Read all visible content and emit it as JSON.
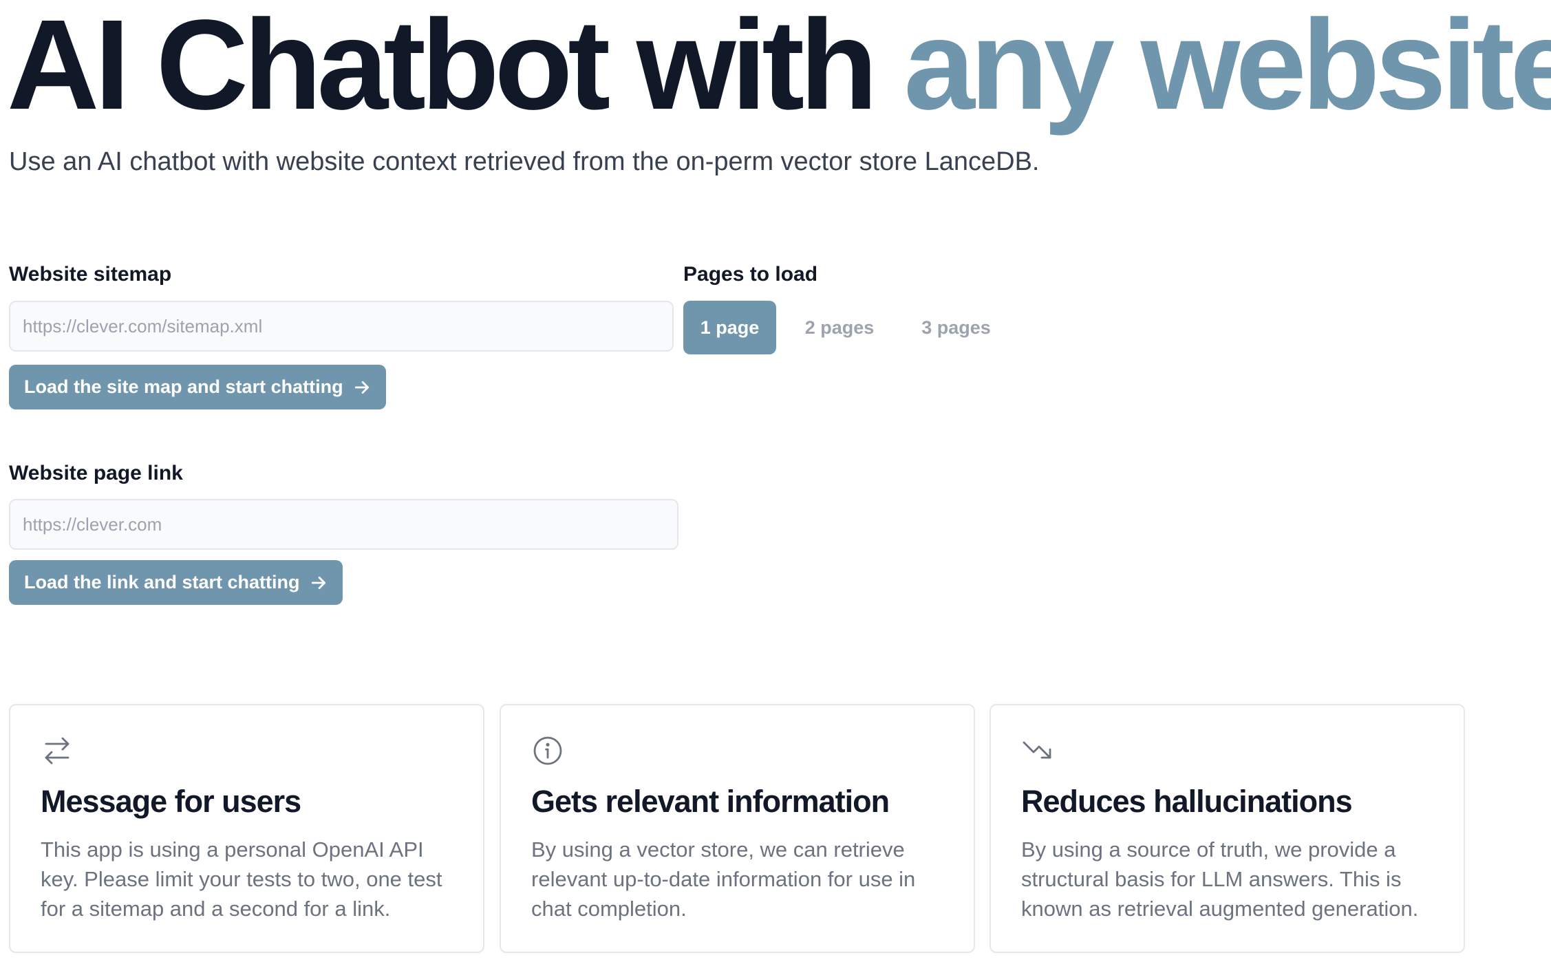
{
  "hero": {
    "title_main": "AI Chatbot with ",
    "title_accent": "any website",
    "subtitle": "Use an AI chatbot with website context retrieved from the on-perm vector store LanceDB."
  },
  "sitemap": {
    "label": "Website sitemap",
    "placeholder": "https://clever.com/sitemap.xml",
    "value": "",
    "button_label": "Load the site map and start chatting"
  },
  "pages_to_load": {
    "label": "Pages to load",
    "options": [
      "1 page",
      "2 pages",
      "3 pages"
    ],
    "selected": "1 page"
  },
  "page_link": {
    "label": "Website page link",
    "placeholder": "https://clever.com",
    "value": "",
    "button_label": "Load the link and start chatting"
  },
  "features": [
    {
      "icon": "arrows-swap-icon",
      "title": "Message for users",
      "text": "This app is using a personal OpenAI API key. Please limit your tests to two, one test for a sitemap and a second for a link."
    },
    {
      "icon": "info-circle-icon",
      "title": "Gets relevant information",
      "text": "By using a vector store, we can retrieve relevant up-to-date information for use in chat completion."
    },
    {
      "icon": "trending-down-icon",
      "title": "Reduces hallucinations",
      "text": "By using a source of truth, we provide a structural basis for LLM answers. This is known as retrieval augmented generation."
    }
  ],
  "colors": {
    "accent": "#7096ad",
    "heading": "#111827",
    "muted_text": "#6b7280",
    "border": "#e5e7eb"
  }
}
